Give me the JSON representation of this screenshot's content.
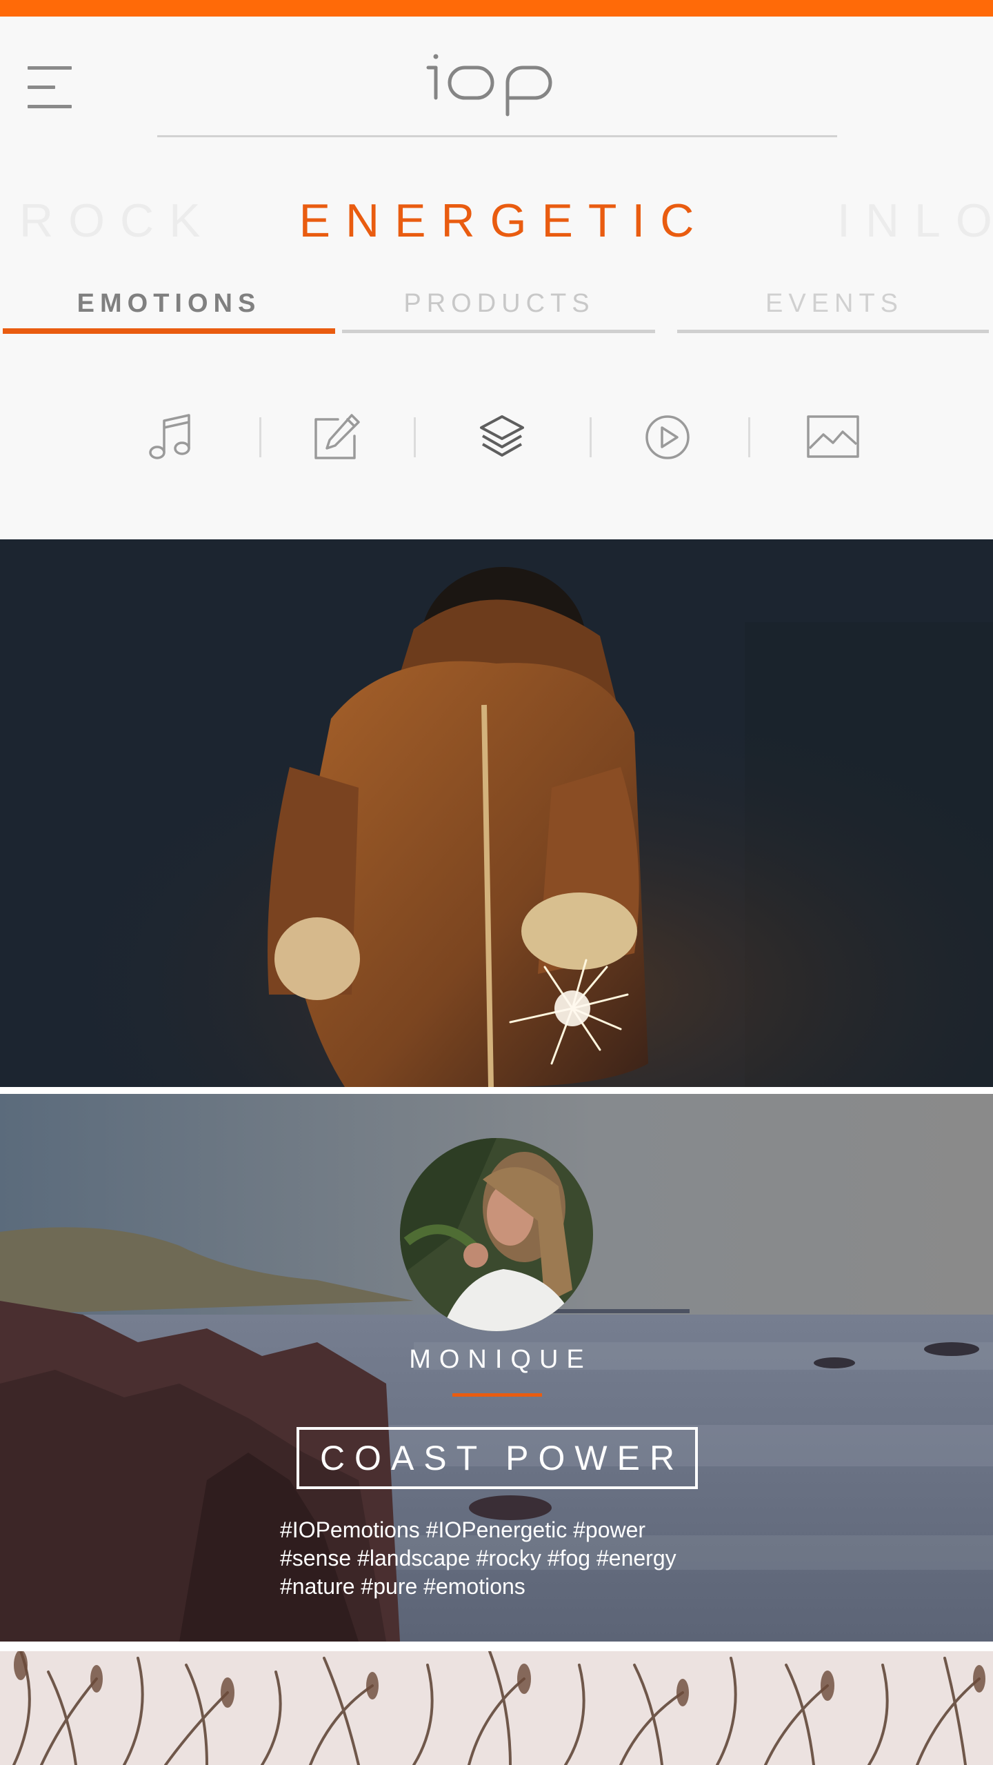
{
  "app": {
    "logo_text": "iop",
    "accent_color": "#e95c10",
    "top_bar_color": "#ff6a08"
  },
  "header": {
    "menu_icon": "hamburger-menu-icon"
  },
  "mood_carousel": {
    "previous": "ROCK",
    "current": "ENERGETIC",
    "next": "INLO"
  },
  "tabs": [
    {
      "label": "EMOTIONS",
      "active": true
    },
    {
      "label": "PRODUCTS",
      "active": false
    },
    {
      "label": "EVENTS",
      "active": false
    }
  ],
  "media_filters": [
    {
      "icon": "music-note-icon",
      "active": false
    },
    {
      "icon": "edit-pencil-icon",
      "active": false
    },
    {
      "icon": "layers-icon",
      "active": true
    },
    {
      "icon": "play-circle-icon",
      "active": false
    },
    {
      "icon": "image-icon",
      "active": false
    }
  ],
  "feed": {
    "hero_image": "child-with-sparkler-photo",
    "post": {
      "author": "MONIQUE",
      "title": "COAST POWER",
      "hashtags": [
        "#IOPemotions #IOPenergetic #power",
        "#sense #landscape #rocky #fog #energy",
        "#nature #pure #emotions"
      ],
      "avatar": "author-avatar-photo",
      "background": "coastal-rocks-photo"
    },
    "next_post_image": "dry-grass-photo"
  }
}
